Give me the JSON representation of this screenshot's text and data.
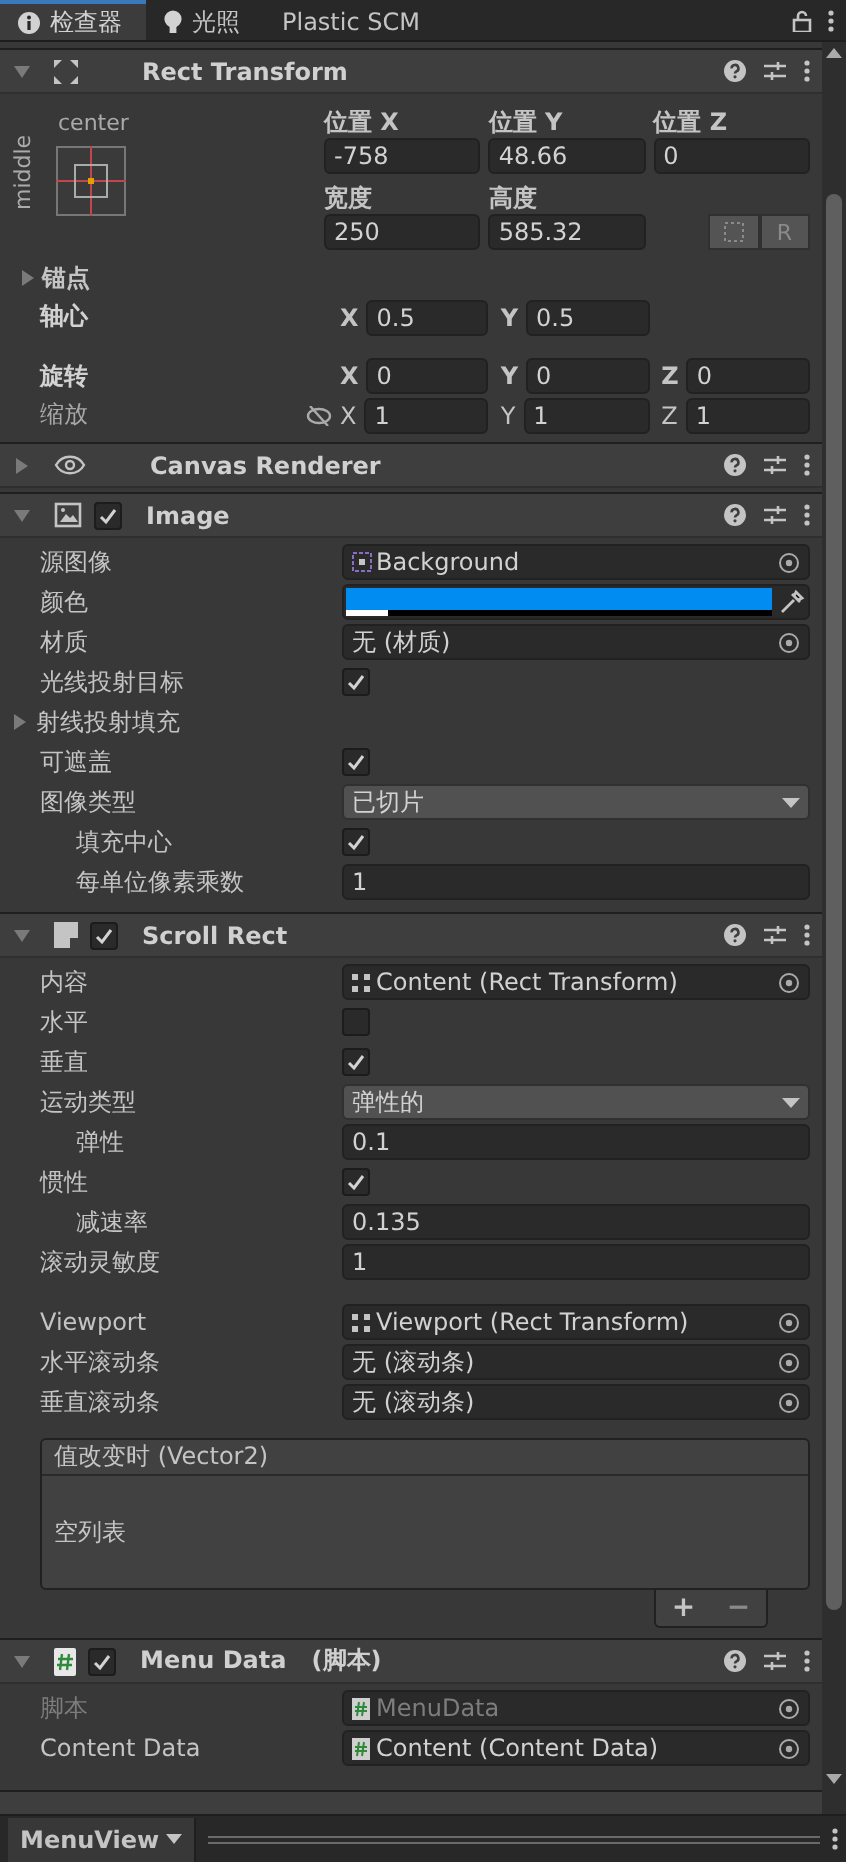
{
  "tabs": [
    {
      "label": "检查器",
      "selected": true
    },
    {
      "label": "光照",
      "selected": false
    },
    {
      "label": "Plastic SCM",
      "selected": false
    }
  ],
  "rect_transform": {
    "title": "Rect Transform",
    "expanded": true,
    "anchor": {
      "horizontal": "center",
      "vertical": "middle"
    },
    "position": [
      {
        "label": "位置 X",
        "value": "-758"
      },
      {
        "label": "位置 Y",
        "value": "48.66"
      },
      {
        "label": "位置 Z",
        "value": "0"
      }
    ],
    "size": [
      {
        "label": "宽度",
        "value": "250"
      },
      {
        "label": "高度",
        "value": "585.32"
      }
    ],
    "raw_button": "R",
    "anchors": {
      "label": "锚点",
      "expanded": false
    },
    "vectors": [
      {
        "label": "轴心",
        "modified": true,
        "parts": [
          {
            "axis": "X",
            "value": "0.5"
          },
          {
            "axis": "Y",
            "value": "0.5"
          }
        ]
      },
      {
        "label": "旋转",
        "modified": true,
        "parts": [
          {
            "axis": "X",
            "value": "0"
          },
          {
            "axis": "Y",
            "value": "0"
          },
          {
            "axis": "Z",
            "value": "0"
          }
        ]
      },
      {
        "label": "缩放",
        "modified": false,
        "parts": [
          {
            "axis": "X",
            "value": "1"
          },
          {
            "axis": "Y",
            "value": "1"
          },
          {
            "axis": "Z",
            "value": "1"
          }
        ]
      }
    ]
  },
  "components": [
    {
      "title": "Canvas Renderer",
      "expanded": false
    },
    {
      "title": "Image",
      "expanded": true,
      "enabled": true,
      "sections": [
        [
          {
            "kind": "object",
            "label": "源图像",
            "value": "Background"
          },
          {
            "kind": "color",
            "label": "颜色",
            "color": "#008cf0",
            "level": 0.1
          },
          {
            "kind": "object",
            "label": "材质",
            "value": "无 (材质)"
          },
          {
            "kind": "checkbox",
            "label": "光线投射目标",
            "checked": true
          },
          {
            "kind": "foldout",
            "label": "射线投射填充",
            "expanded": false
          },
          {
            "kind": "checkbox",
            "label": "可遮盖",
            "checked": true
          },
          {
            "kind": "dropdown",
            "label": "图像类型",
            "value": "已切片",
            "children": [
              {
                "kind": "checkbox",
                "label": "填充中心",
                "checked": true
              },
              {
                "kind": "text",
                "label": "每单位像素乘数",
                "value": "1"
              }
            ]
          }
        ]
      ]
    },
    {
      "title": "Scroll Rect",
      "expanded": true,
      "enabled": true,
      "sections": [
        [
          {
            "kind": "object",
            "label": "内容",
            "value": "Content (Rect Transform)"
          },
          {
            "kind": "checkbox",
            "label": "水平",
            "checked": false
          },
          {
            "kind": "checkbox",
            "label": "垂直",
            "checked": true
          },
          {
            "kind": "dropdown",
            "label": "运动类型",
            "value": "弹性的",
            "children": [
              {
                "kind": "text",
                "label": "弹性",
                "value": "0.1"
              }
            ]
          },
          {
            "kind": "checkbox",
            "label": "惯性",
            "checked": true,
            "children": [
              {
                "kind": "text",
                "label": "减速率",
                "value": "0.135"
              }
            ]
          },
          {
            "kind": "text",
            "label": "滚动灵敏度",
            "value": "1"
          }
        ],
        [
          {
            "kind": "object",
            "label": "Viewport",
            "value": "Viewport (Rect Transform)"
          },
          {
            "kind": "object",
            "label": "水平滚动条",
            "value": "无 (滚动条)"
          },
          {
            "kind": "object",
            "label": "垂直滚动条",
            "value": "无 (滚动条)"
          }
        ]
      ],
      "event": {
        "title": "值改变时 (Vector2)",
        "empty": "空列表",
        "add": "+",
        "remove": "−"
      }
    },
    {
      "title": "Menu Data",
      "suffix": "(脚本)",
      "expanded": true,
      "enabled": true,
      "sections": [
        [
          {
            "kind": "object",
            "label": "脚本",
            "value": "MenuData",
            "disabled": true
          },
          {
            "kind": "object",
            "label": "Content Data",
            "value": "Content (Content Data)"
          }
        ]
      ]
    }
  ],
  "footer": {
    "object": "MenuView"
  }
}
